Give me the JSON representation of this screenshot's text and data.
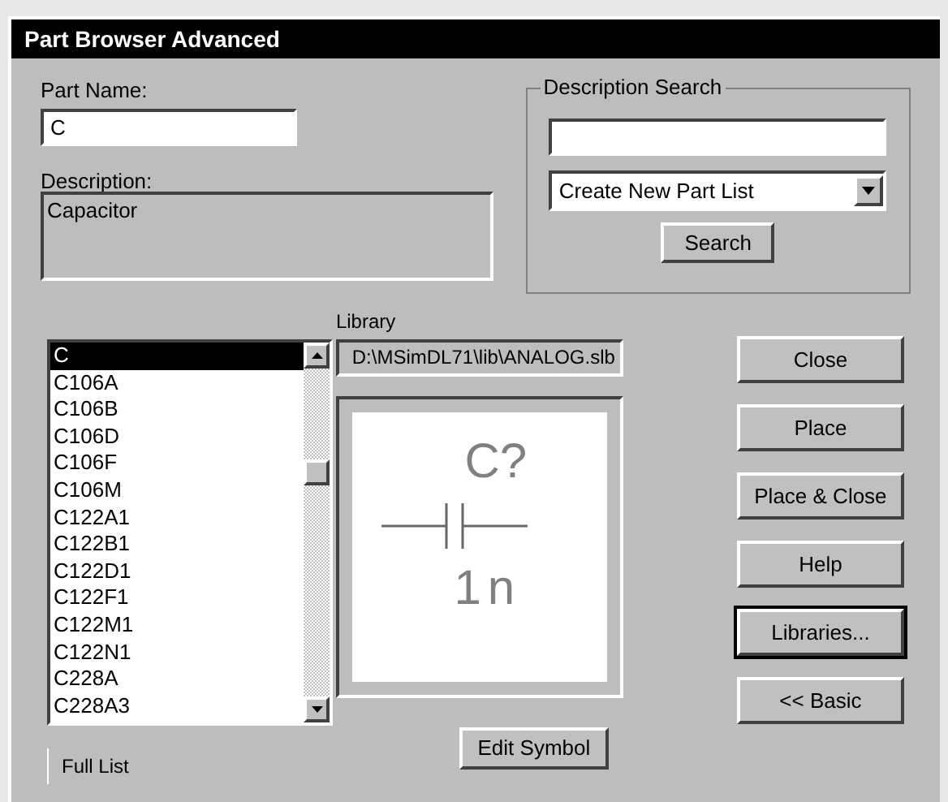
{
  "window": {
    "title": "Part Browser Advanced"
  },
  "part_name": {
    "label": "Part Name:",
    "value": "C"
  },
  "description": {
    "label": "Description:",
    "value": "Capacitor"
  },
  "description_search": {
    "label": "Description Search",
    "list_option": "Create New Part List",
    "button": {
      "label": "Search"
    }
  },
  "library": {
    "label": "Library",
    "path": "D:\\MSimDL71\\lib\\ANALOG.slb"
  },
  "parts": [
    {
      "name": "C",
      "selected": true
    },
    {
      "name": "C106A",
      "selected": false
    },
    {
      "name": "C106B",
      "selected": false
    },
    {
      "name": "C106D",
      "selected": false
    },
    {
      "name": "C106F",
      "selected": false
    },
    {
      "name": "C106M",
      "selected": false
    },
    {
      "name": "C122A1",
      "selected": false
    },
    {
      "name": "C122B1",
      "selected": false
    },
    {
      "name": "C122D1",
      "selected": false
    },
    {
      "name": "C122F1",
      "selected": false
    },
    {
      "name": "C122M1",
      "selected": false
    },
    {
      "name": "C122N1",
      "selected": false
    },
    {
      "name": "C228A",
      "selected": false
    },
    {
      "name": "C228A3",
      "selected": false
    }
  ],
  "preview": {
    "refdes": "C?",
    "value": "1n"
  },
  "buttons": [
    {
      "label": "Close",
      "default": false
    },
    {
      "label": "Place",
      "default": false
    },
    {
      "label": "Place & Close",
      "default": false
    },
    {
      "label": "Help",
      "default": false
    },
    {
      "label": "Libraries...",
      "default": true
    },
    {
      "label": "<< Basic",
      "default": false
    }
  ],
  "full_list": {
    "label": "Full List"
  },
  "edit_symbol": {
    "label": "Edit Symbol"
  }
}
